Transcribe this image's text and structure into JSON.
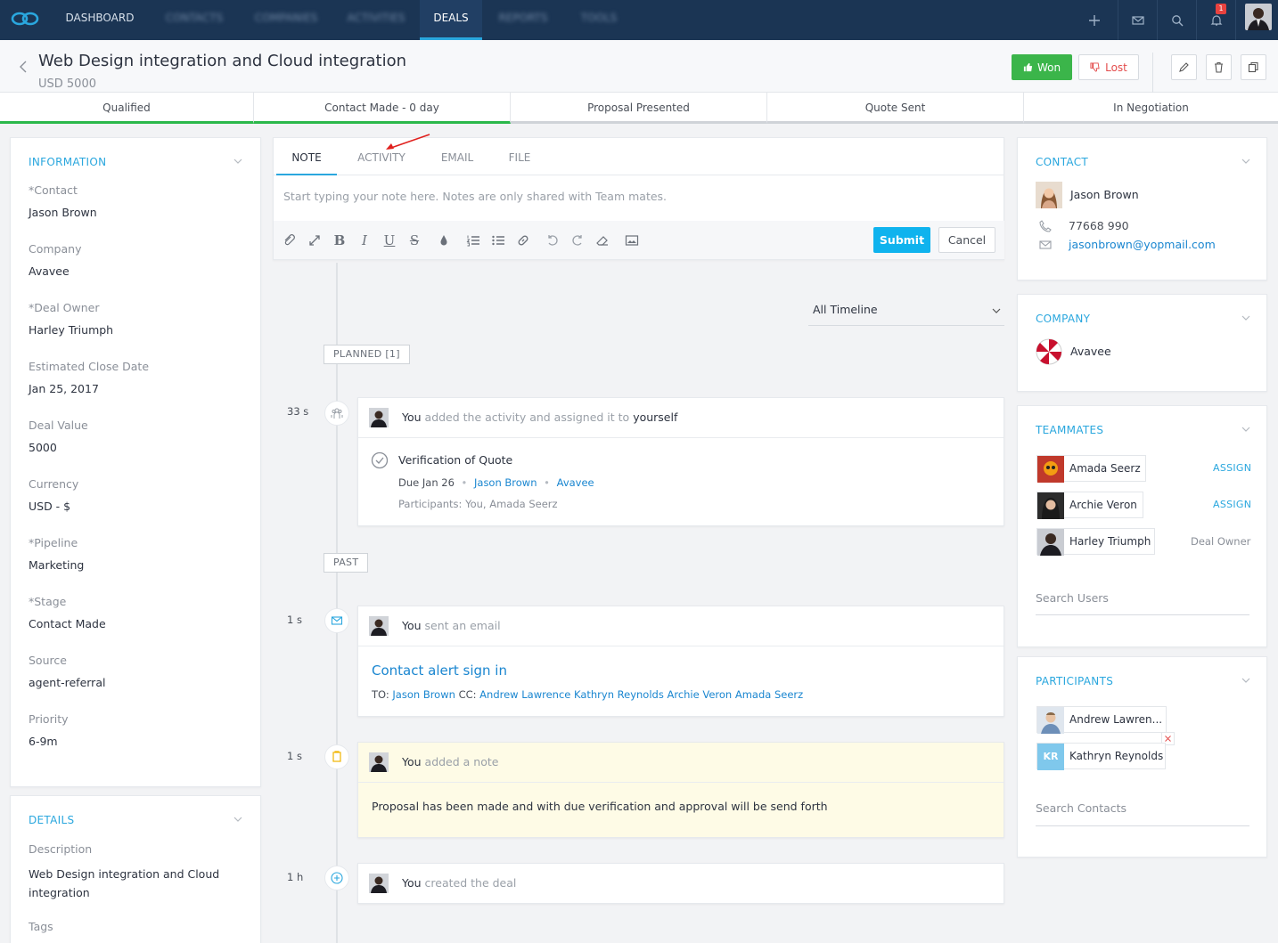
{
  "nav": {
    "items": [
      "DASHBOARD",
      "CONTACTS",
      "COMPANIES",
      "ACTIVITIES",
      "DEALS",
      "REPORTS",
      "TOOLS"
    ],
    "notification_count": "1"
  },
  "header": {
    "title": "Web Design integration and Cloud integration",
    "amount": "USD 5000",
    "won_label": "Won",
    "lost_label": "Lost"
  },
  "stages": [
    "Qualified",
    "Contact Made - 0 day",
    "Proposal Presented",
    "Quote Sent",
    "In Negotiation"
  ],
  "information": {
    "title": "INFORMATION",
    "fields": [
      {
        "label": "*Contact",
        "value": "Jason Brown"
      },
      {
        "label": "Company",
        "value": "Avavee"
      },
      {
        "label": "*Deal Owner",
        "value": "Harley Triumph"
      },
      {
        "label": "Estimated Close Date",
        "value": "Jan 25, 2017"
      },
      {
        "label": "Deal Value",
        "value": "5000"
      },
      {
        "label": "Currency",
        "value": "USD - $"
      },
      {
        "label": "*Pipeline",
        "value": "Marketing"
      },
      {
        "label": "*Stage",
        "value": "Contact Made"
      },
      {
        "label": "Source",
        "value": "agent-referral"
      },
      {
        "label": "Priority",
        "value": "6-9m"
      }
    ]
  },
  "details": {
    "title": "DETAILS",
    "description_label": "Description",
    "description": "Web Design integration and Cloud integration",
    "tags_label": "Tags"
  },
  "editor": {
    "tabs": [
      "NOTE",
      "ACTIVITY",
      "EMAIL",
      "FILE"
    ],
    "placeholder": "Start typing your note here. Notes are only shared with Team mates.",
    "submit": "Submit",
    "cancel": "Cancel"
  },
  "timeline": {
    "filter": "All Timeline",
    "planned_tag": "PLANNED [1]",
    "past_tag": "PAST",
    "entries": [
      {
        "time": "33 s",
        "you": "You",
        "action": "added the activity and assigned it to",
        "target": "yourself",
        "task": "Verification of Quote",
        "due": "Due Jan 26",
        "contact": "Jason Brown",
        "company": "Avavee",
        "participants": "Participants: You, Amada Seerz"
      },
      {
        "time": "1 s",
        "you": "You",
        "action": "sent an email",
        "subject": "Contact alert sign in",
        "to_label": "TO:",
        "to": "Jason Brown",
        "cc_label": "CC:",
        "cc": "Andrew Lawrence Kathryn Reynolds Archie Veron Amada Seerz"
      },
      {
        "time": "1 s",
        "you": "You",
        "action": "added a note",
        "note": "Proposal has been made and with due verification and approval will be send forth"
      },
      {
        "time": "1 h",
        "you": "You",
        "action": "created the deal"
      }
    ]
  },
  "contact": {
    "title": "CONTACT",
    "name": "Jason Brown",
    "phone": "77668 990",
    "email": "jasonbrown@yopmail.com"
  },
  "company": {
    "title": "COMPANY",
    "name": "Avavee"
  },
  "teammates": {
    "title": "TEAMMATES",
    "members": [
      {
        "name": "Amada Seerz",
        "role": "ASSIGN"
      },
      {
        "name": "Archie Veron",
        "role": "ASSIGN"
      },
      {
        "name": "Harley Triumph",
        "role": "Deal Owner"
      }
    ],
    "search_placeholder": "Search Users"
  },
  "participants": {
    "title": "PARTICIPANTS",
    "members": [
      {
        "name": "Andrew Lawren...",
        "initials": ""
      },
      {
        "name": "Kathryn Reynolds",
        "initials": "KR"
      }
    ],
    "search_placeholder": "Search Contacts"
  },
  "colors": {
    "nav_bg": "#1b3554",
    "accent": "#2aa7de",
    "won": "#3bb54a",
    "lost": "#e34c4c",
    "submit": "#0fb3ee",
    "stage_done": "#2ab84a"
  }
}
